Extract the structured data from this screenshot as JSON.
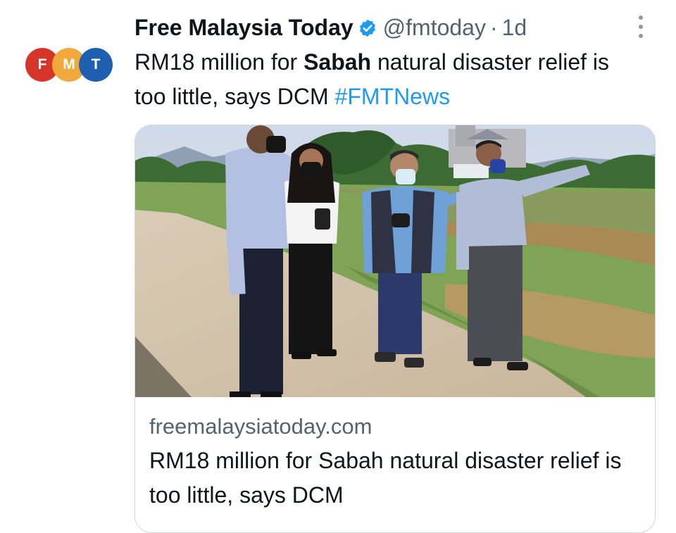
{
  "account": {
    "display_name": "Free Malaysia Today",
    "handle": "@fmtoday",
    "separator": "·",
    "time": "1d",
    "avatar_letters": [
      "F",
      "M",
      "T"
    ]
  },
  "tweet": {
    "text_part1": "RM18 million for ",
    "text_bold": "Sabah",
    "text_part2": " natural disaster relief is too little, says DCM ",
    "hashtag": "#FMTNews"
  },
  "card": {
    "domain": "freemalaysiatoday.com",
    "title": "RM18 million for Sabah natural disaster relief is too little, says DCM"
  },
  "colors": {
    "link": "#1d9bf0",
    "secondary_text": "#536471",
    "avatar": [
      "#d6352a",
      "#f2a93b",
      "#1e5fb0"
    ]
  },
  "icons": {
    "verified": "verified-badge-icon",
    "more": "more-options-icon"
  }
}
